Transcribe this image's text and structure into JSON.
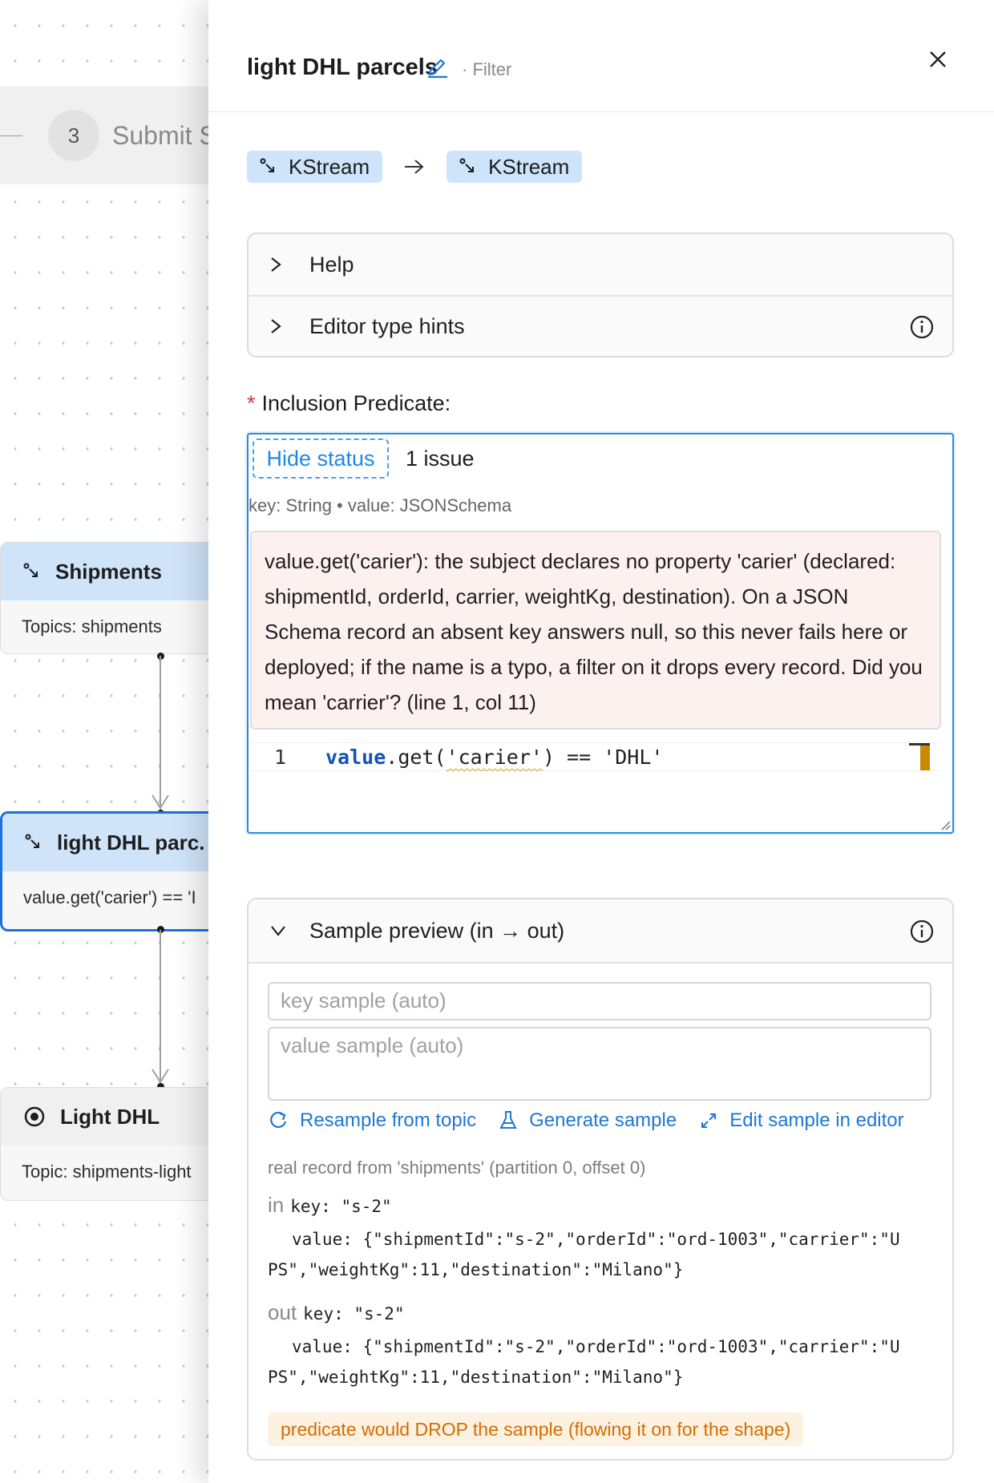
{
  "canvas": {
    "step": {
      "number": "3",
      "label": "Submit S"
    },
    "nodes": [
      {
        "title": "Shipments",
        "body": "Topics: shipments"
      },
      {
        "title": "light DHL parc.",
        "body": "value.get('carier') == 'I"
      },
      {
        "title": "Light DHL",
        "body": "Topic: shipments-light"
      }
    ]
  },
  "drawer": {
    "title": "light DHL parcels",
    "subtitle": "· Filter",
    "input_type": "KStream",
    "output_type": "KStream",
    "accordion": [
      {
        "label": "Help"
      },
      {
        "label": "Editor type hints"
      }
    ],
    "predicate": {
      "label": "Inclusion Predicate:",
      "hide_status": "Hide status",
      "issue_count": "1 issue",
      "type_hint": "key: String • value: JSONSchema",
      "issue_message": "value.get('carier'): the subject declares no property 'carier' (declared: shipmentId, orderId, carrier, weightKg, destination). On a JSON Schema record an absent key answers null, so this never fails here or deployed; if the name is a typo, a filter on it drops every record. Did you mean 'carrier'? (line 1, col 11)",
      "line_number": "1",
      "code": {
        "kw": "value",
        "call": ".get(",
        "arg": "'carier'",
        "rest": ") == 'DHL'"
      }
    },
    "sample": {
      "title": "Sample preview (in → out)",
      "key_placeholder": "key sample (auto)",
      "value_placeholder": "value sample (auto)",
      "actions": {
        "resample": "Resample from topic",
        "generate": "Generate sample",
        "edit": "Edit sample in editor"
      },
      "provenance": "real record from 'shipments' (partition 0, offset 0)",
      "in": {
        "tag": "in",
        "key": "key: \"s-2\"",
        "value_line1": "value: {\"shipmentId\":\"s-2\",\"orderId\":\"ord-1003\",\"carrier\":\"U",
        "value_line2": "PS\",\"weightKg\":11,\"destination\":\"Milano\"}"
      },
      "out": {
        "tag": "out",
        "key": "key: \"s-2\"",
        "value_line1": "value: {\"shipmentId\":\"s-2\",\"orderId\":\"ord-1003\",\"carrier\":\"U",
        "value_line2": "PS\",\"weightKg\":11,\"destination\":\"Milano\"}"
      },
      "note": "predicate would DROP the sample (flowing it on for the shape)"
    }
  },
  "colors": {
    "accent": "#1f6fe0",
    "chip": "#cde4fb",
    "issue_bg": "#fdf1ef",
    "warning_text": "#d36e00",
    "warning_bg": "#fdf1e2"
  }
}
